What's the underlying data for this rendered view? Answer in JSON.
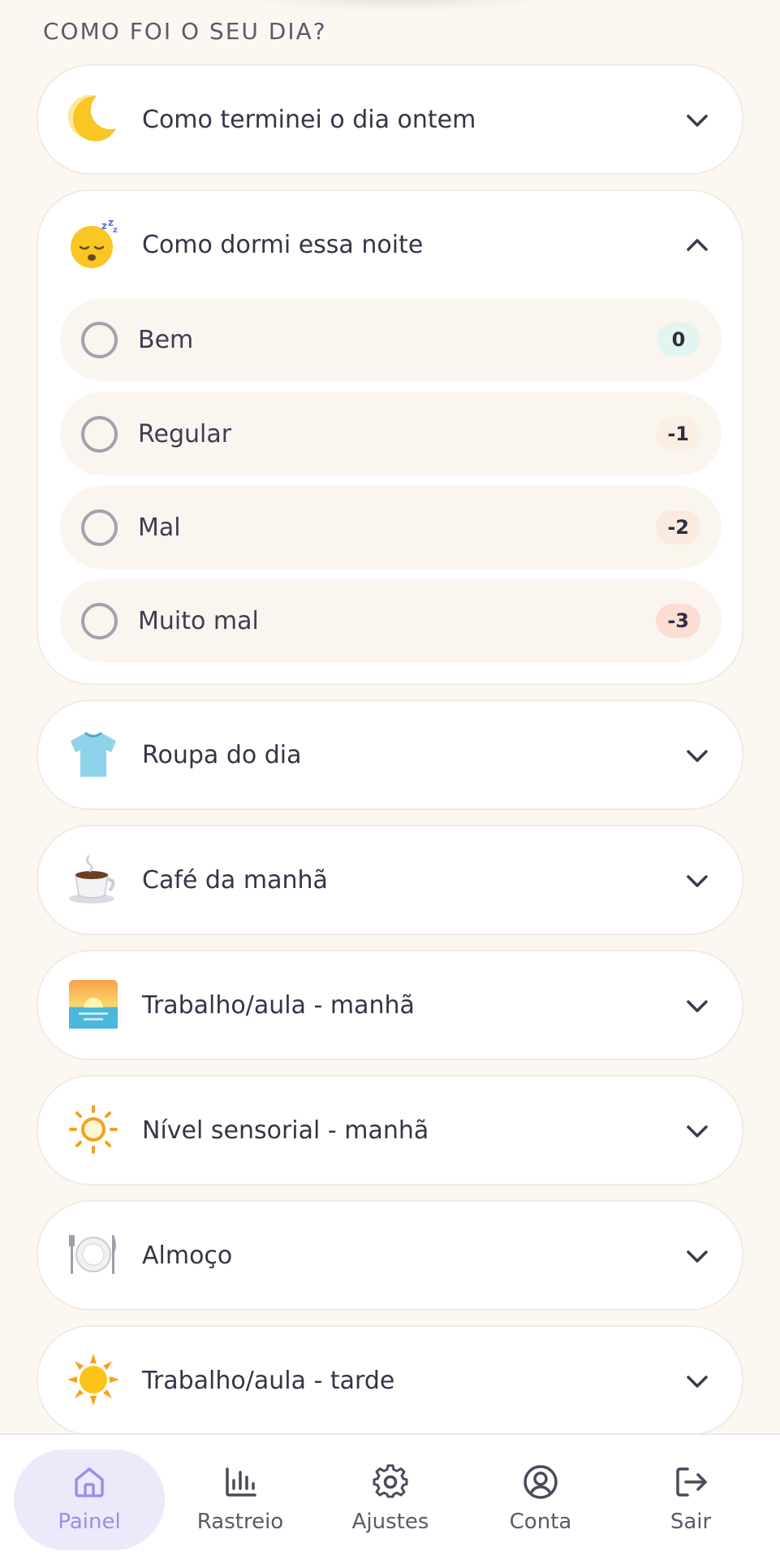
{
  "section_title": "COMO FOI O SEU DIA?",
  "cards": [
    {
      "title": "Como terminei o dia ontem",
      "icon": "crescent-moon",
      "expanded": false
    },
    {
      "title": "Como dormi essa noite",
      "icon": "sleeping-face",
      "expanded": true
    },
    {
      "title": "Roupa do dia",
      "icon": "t-shirt",
      "expanded": false
    },
    {
      "title": "Café da manhã",
      "icon": "hot-coffee",
      "expanded": false
    },
    {
      "title": "Trabalho/aula - manhã",
      "icon": "sunrise",
      "expanded": false
    },
    {
      "title": "Nível sensorial - manhã",
      "icon": "sun-outline",
      "expanded": false
    },
    {
      "title": "Almoço",
      "icon": "plate-cutlery",
      "expanded": false
    },
    {
      "title": "Trabalho/aula - tarde",
      "icon": "sun",
      "expanded": false
    }
  ],
  "sleep_options": [
    {
      "label": "Bem",
      "score": "0",
      "badge_color": "#e2f5ee",
      "selected": false
    },
    {
      "label": "Regular",
      "score": "-1",
      "badge_color": "#fbefe3",
      "selected": false
    },
    {
      "label": "Mal",
      "score": "-2",
      "badge_color": "#fbeadf",
      "selected": false
    },
    {
      "label": "Muito mal",
      "score": "-3",
      "badge_color": "#fbddd3",
      "selected": false
    }
  ],
  "nav": [
    {
      "label": "Painel",
      "icon": "home-icon",
      "active": true
    },
    {
      "label": "Rastreio",
      "icon": "bar-chart-icon",
      "active": false
    },
    {
      "label": "Ajustes",
      "icon": "gear-icon",
      "active": false
    },
    {
      "label": "Conta",
      "icon": "user-circle-icon",
      "active": false
    },
    {
      "label": "Sair",
      "icon": "logout-icon",
      "active": false
    }
  ],
  "colors": {
    "background": "#fcf7f1",
    "accent": "#9b8fe4",
    "accent_bg": "#ece9fb"
  }
}
